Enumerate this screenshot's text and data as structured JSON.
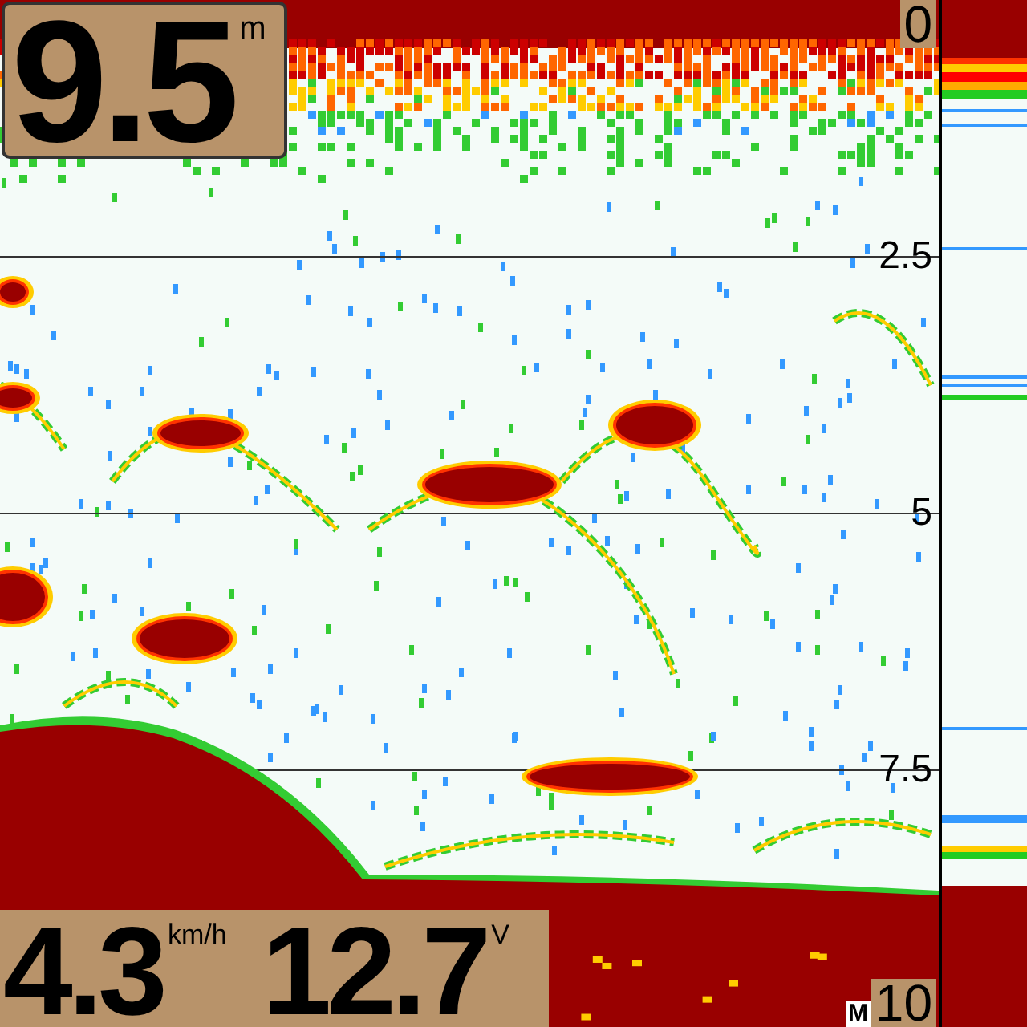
{
  "depth": {
    "value": "9.5",
    "unit": "m"
  },
  "depth_scale": [
    {
      "label": "0"
    },
    {
      "label": "2.5"
    },
    {
      "label": "5"
    },
    {
      "label": "7.5"
    },
    {
      "label": "10"
    }
  ],
  "range_mode": "M",
  "speed": {
    "value": "4.3",
    "unit": "km/h"
  },
  "voltage": {
    "value": "12.7",
    "unit": "V"
  }
}
